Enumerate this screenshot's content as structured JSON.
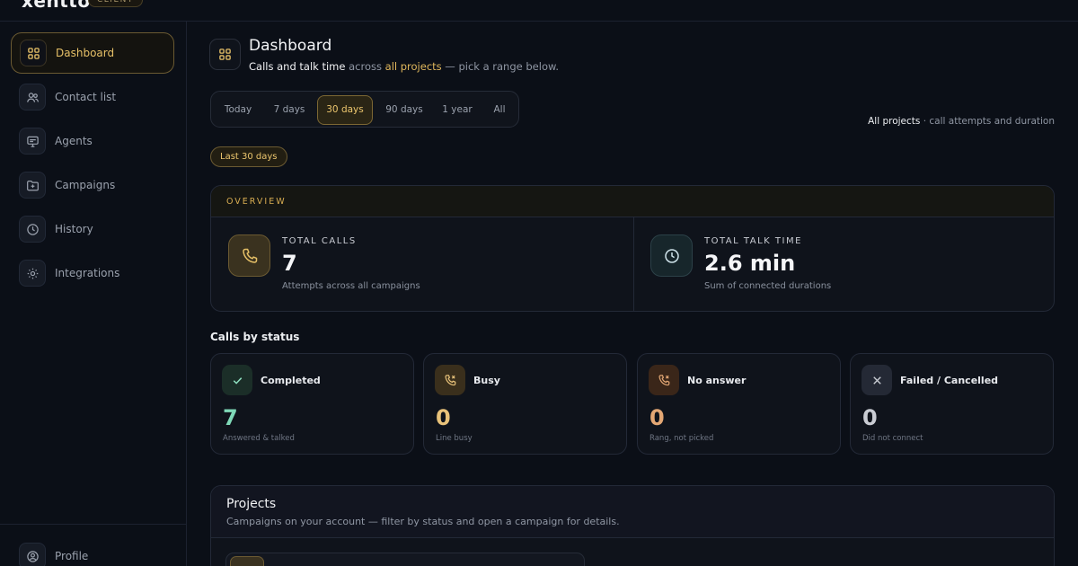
{
  "brand": {
    "name": "xentto",
    "badge": "CLIENT"
  },
  "sidebar": {
    "items": [
      {
        "label": "Dashboard",
        "icon": "grid-icon",
        "active": true
      },
      {
        "label": "Contact list",
        "icon": "users-icon"
      },
      {
        "label": "Agents",
        "icon": "monitor-icon"
      },
      {
        "label": "Campaigns",
        "icon": "folder-plus-icon"
      },
      {
        "label": "History",
        "icon": "clock-icon"
      },
      {
        "label": "Integrations",
        "icon": "gear-icon"
      }
    ],
    "profile": {
      "label": "Profile",
      "icon": "user-circle-icon"
    }
  },
  "header": {
    "title": "Dashboard",
    "sub_strong": "Calls and talk time",
    "sub_mid": " across ",
    "sub_link": "all projects",
    "sub_tail": " — pick a range below."
  },
  "range": {
    "options": [
      "Today",
      "7 days",
      "30 days",
      "90 days",
      "1 year",
      "All"
    ],
    "selected": "30 days"
  },
  "scope": {
    "strong": "All projects",
    "rest": " · call attempts and duration"
  },
  "active_range_pill": "Last 30 days",
  "overview": {
    "heading": "OVERVIEW",
    "total_calls": {
      "label": "TOTAL CALLS",
      "value": "7",
      "note": "Attempts across all campaigns"
    },
    "talk_time": {
      "label": "TOTAL TALK TIME",
      "value": "2.6 min",
      "note": "Sum of connected durations"
    }
  },
  "status": {
    "title": "Calls by status",
    "cards": [
      {
        "label": "Completed",
        "value": "7",
        "note": "Answered & talked",
        "color": "#7fd9b8"
      },
      {
        "label": "Busy",
        "value": "0",
        "note": "Line busy",
        "color": "#e8c27a"
      },
      {
        "label": "No answer",
        "value": "0",
        "note": "Rang, not picked",
        "color": "#e3a774"
      },
      {
        "label": "Failed / Cancelled",
        "value": "0",
        "note": "Did not connect",
        "color": "#c9ccd3"
      }
    ]
  },
  "projects": {
    "title": "Projects",
    "subtitle": "Campaigns on your account — filter by status and open a campaign for details."
  },
  "colors": {
    "accent": "#e0b75c",
    "background": "#0b0f17",
    "card": "#0f131b"
  }
}
